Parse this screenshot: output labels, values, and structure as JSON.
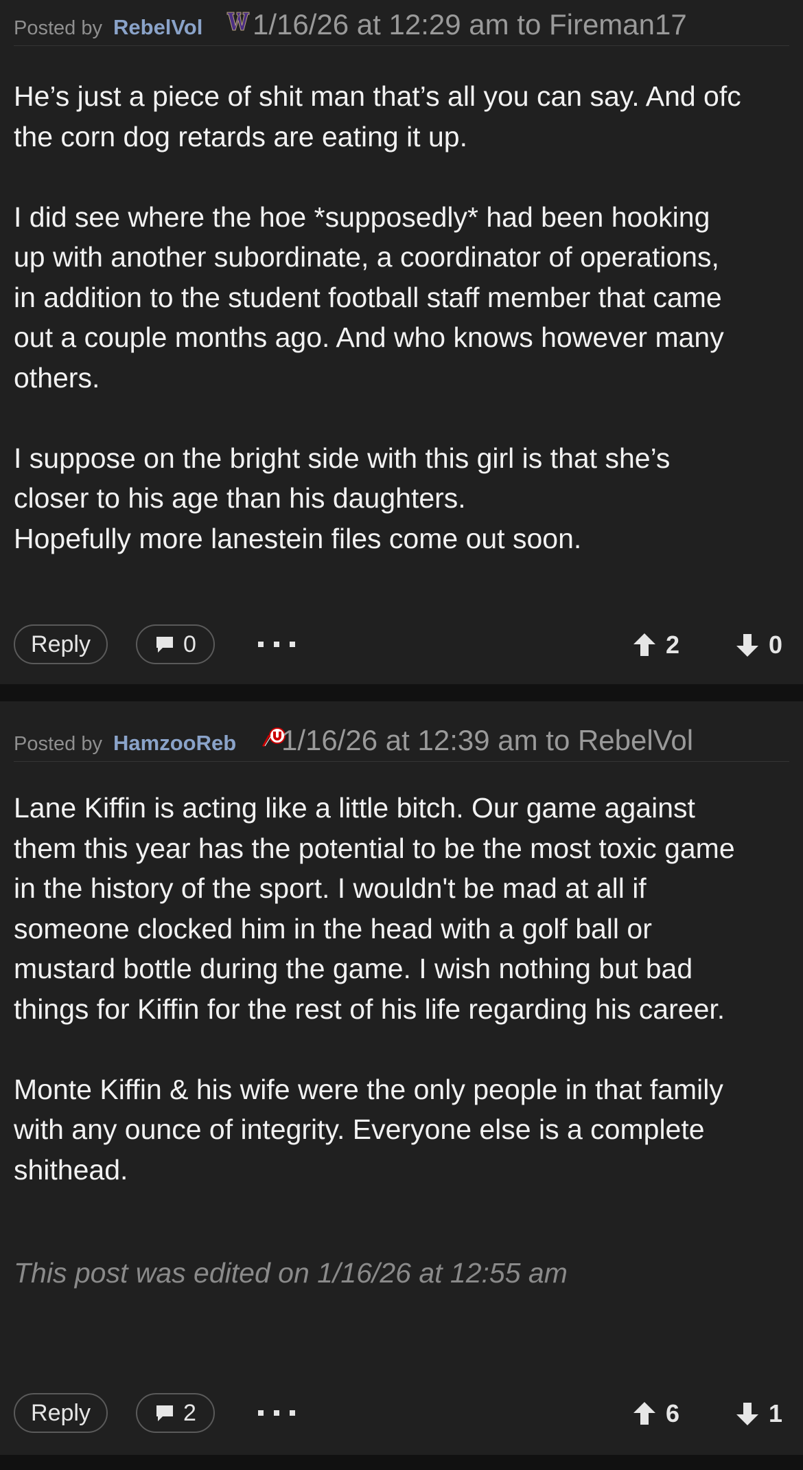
{
  "posts": [
    {
      "posted_by_label": "Posted by",
      "author": "RebelVol",
      "team_logo": "washington-w-logo",
      "meta": "1/16/26 at 12:29 am to Fireman17",
      "paragraphs": [
        [
          "He’s just a piece of shit man that’s all you can say. And ofc",
          "the corn dog retards are eating it up."
        ],
        [
          "I did see where the hoe *supposedly* had been hooking",
          "up with another subordinate, a coordinator of operations,",
          "in addition to the student football staff member that came",
          "out a couple months ago. And who knows however many",
          "others."
        ],
        [
          "I suppose on the bright side with this girl is that she’s",
          "closer to his age than his daughters.",
          "Hopefully more lanestein files come out soon."
        ]
      ],
      "edited": "",
      "reply_label": "Reply",
      "comment_count": "0",
      "upvotes": "2",
      "downvotes": "0"
    },
    {
      "posted_by_label": "Posted by",
      "author": "HamzooReb",
      "team_logo": "utah-u-logo",
      "meta": "1/16/26 at 12:39 am to RebelVol",
      "paragraphs": [
        [
          "Lane Kiffin is acting like a little bitch. Our game against",
          "them this year has the potential to be the most toxic game",
          "in the history of the sport. I wouldn't be mad at all if",
          "someone clocked him in the head with a golf ball or",
          "mustard bottle during the game. I wish nothing but bad",
          "things for Kiffin for the rest of his life regarding his career."
        ],
        [
          "Monte Kiffin & his wife were the only people in that family",
          "with any ounce of integrity. Everyone else is a complete",
          "shithead."
        ]
      ],
      "edited": "This post was edited on 1/16/26 at 12:55 am",
      "reply_label": "Reply",
      "comment_count": "2",
      "upvotes": "6",
      "downvotes": "1"
    }
  ],
  "colors": {
    "page_background": "#111111",
    "post_background": "#202020",
    "author_link": "#8aa3c9",
    "meta_text": "#9a9a9a",
    "body_text": "#f2f2f2",
    "edited_text": "#8a8a8a",
    "washington_purple": "#4b2e83",
    "utah_red": "#cc0000"
  },
  "icons": {
    "comment": "speech-bubble-icon",
    "more": "more-dots-icon",
    "upvote": "arrow-up-icon",
    "downvote": "arrow-down-icon"
  }
}
